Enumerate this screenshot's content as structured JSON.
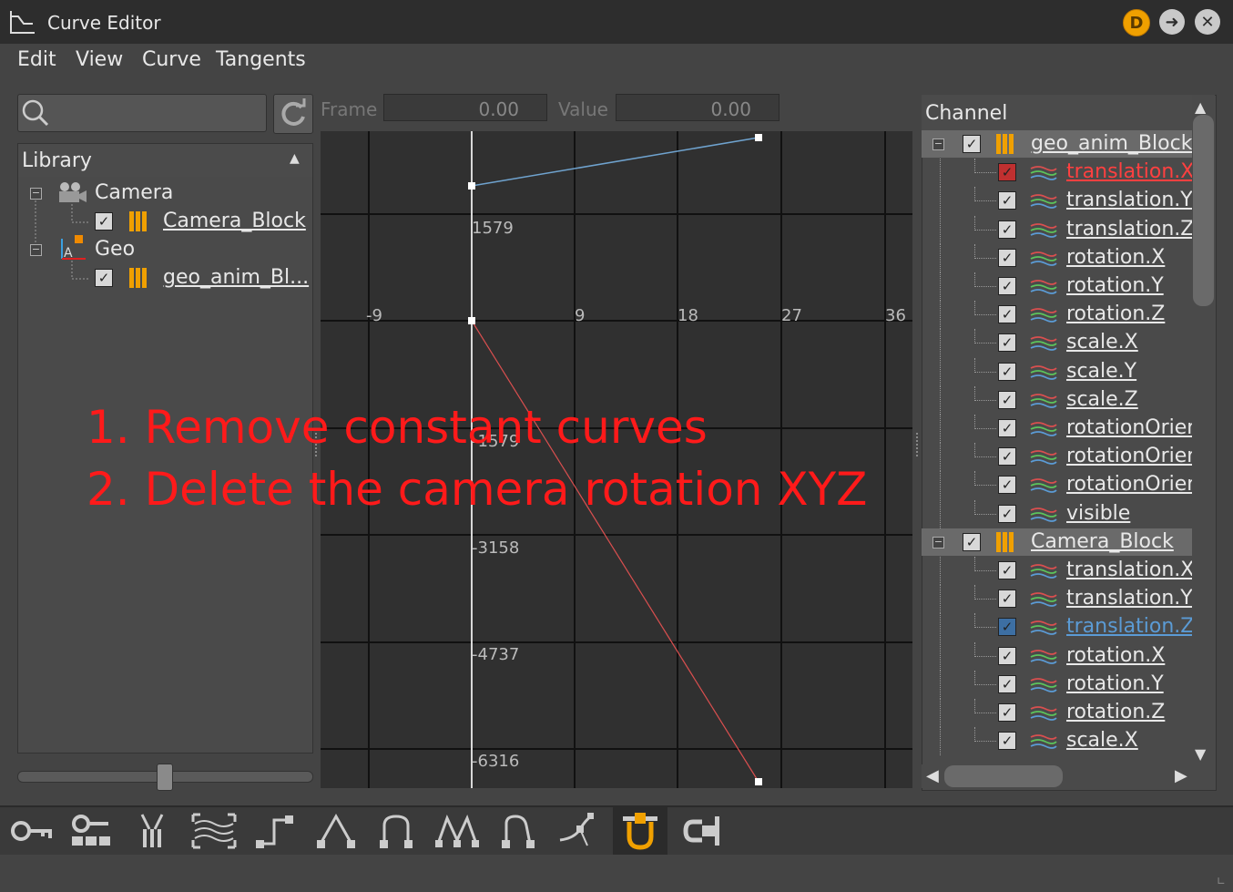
{
  "window": {
    "title": "Curve Editor",
    "buttons": {
      "d_label": "D"
    }
  },
  "menu": [
    "Edit",
    "View",
    "Curve",
    "Tangents"
  ],
  "search": {
    "placeholder": ""
  },
  "library": {
    "title": "Library",
    "items": [
      {
        "label": "Camera",
        "children": [
          {
            "label": "Camera_Block",
            "checked": true
          }
        ]
      },
      {
        "label": "Geo",
        "children": [
          {
            "label": "geo_anim_Bl...",
            "checked": true
          }
        ]
      }
    ],
    "zoom_slider_value": 0.5
  },
  "graph": {
    "frame_label": "Frame",
    "frame_value": "0.00",
    "value_label": "Value",
    "value_value": "0.00",
    "x_ticks": [
      "-9",
      "9",
      "18",
      "27",
      "36"
    ],
    "y_ticks": [
      "1579",
      "-1579",
      "-3158",
      "-4737",
      "-6316"
    ]
  },
  "channel": {
    "title": "Channel",
    "groups": [
      {
        "label": "geo_anim_Block",
        "channels": [
          {
            "label": "translation.X",
            "state": "selected-red"
          },
          {
            "label": "translation.Y",
            "state": "normal"
          },
          {
            "label": "translation.Z",
            "state": "normal"
          },
          {
            "label": "rotation.X",
            "state": "normal"
          },
          {
            "label": "rotation.Y",
            "state": "normal"
          },
          {
            "label": "rotation.Z",
            "state": "normal"
          },
          {
            "label": "scale.X",
            "state": "normal"
          },
          {
            "label": "scale.Y",
            "state": "normal"
          },
          {
            "label": "scale.Z",
            "state": "normal"
          },
          {
            "label": "rotationOrien",
            "state": "normal"
          },
          {
            "label": "rotationOrien",
            "state": "normal"
          },
          {
            "label": "rotationOrien",
            "state": "normal"
          },
          {
            "label": "visible",
            "state": "normal"
          }
        ]
      },
      {
        "label": "Camera_Block",
        "channels": [
          {
            "label": "translation.X",
            "state": "normal"
          },
          {
            "label": "translation.Y",
            "state": "normal"
          },
          {
            "label": "translation.Z",
            "state": "selected-blue"
          },
          {
            "label": "rotation.X",
            "state": "normal"
          },
          {
            "label": "rotation.Y",
            "state": "normal"
          },
          {
            "label": "rotation.Z",
            "state": "normal"
          },
          {
            "label": "scale.X",
            "state": "normal"
          }
        ]
      }
    ]
  },
  "toolbar": {
    "tools": [
      "key-icon",
      "keys-icon",
      "bundle-icon",
      "fit-icon",
      "step-tangent-icon",
      "linear-tangent-icon",
      "flat-tangent-icon",
      "auto-tangent-icon",
      "spline-tangent-icon",
      "break-tangent-icon",
      "magnet-snap-icon",
      "lock-tangent-icon"
    ],
    "active": "magnet-snap-icon"
  },
  "annotations": [
    "1. Remove constant curves",
    "2. Delete the camera rotation XYZ"
  ],
  "colors": {
    "accent_orange": "#f0a000",
    "selected_red": "#ff4040",
    "selected_blue": "#5b9bd5",
    "annotation_red": "#ff1a1a",
    "curve_blue": "#6fa3cf",
    "curve_red": "#d94f4f"
  }
}
